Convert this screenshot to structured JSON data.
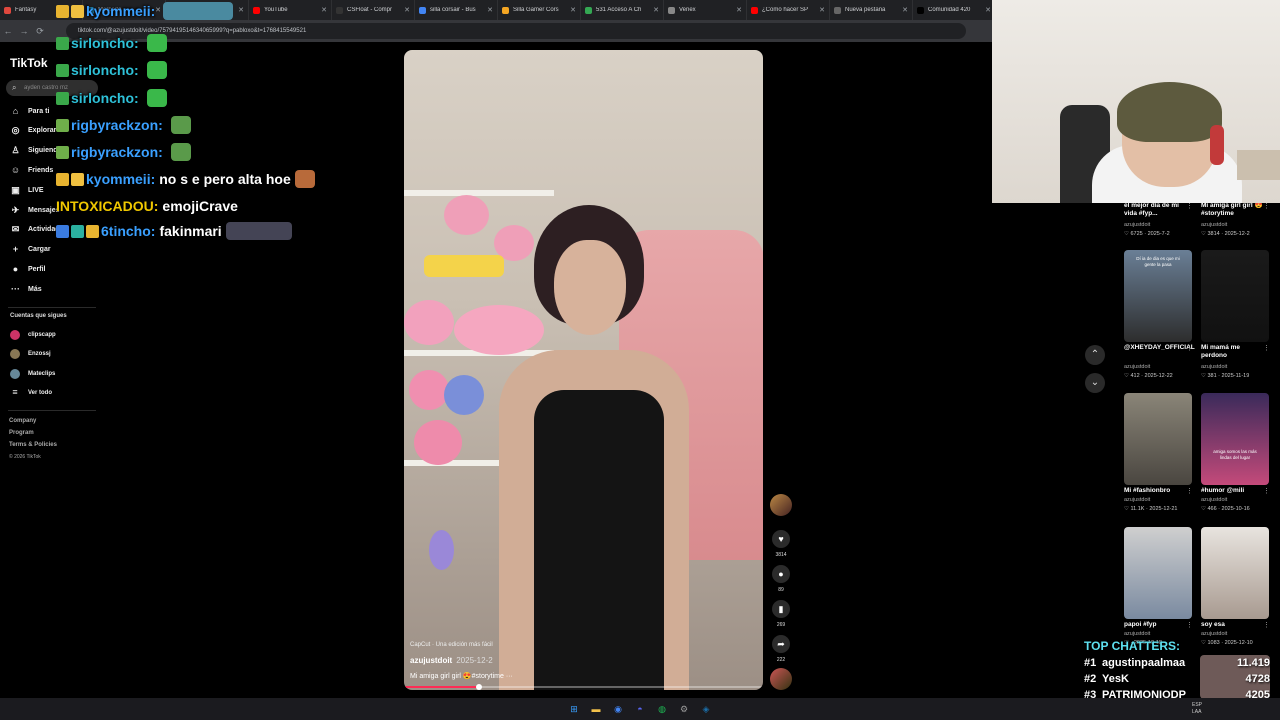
{
  "browser": {
    "tabs": [
      {
        "title": "Fantasy",
        "color": "#e0483e"
      },
      {
        "title": "Mercado",
        "color": "#2aa8e0"
      },
      {
        "title": "Stream",
        "color": "#9147ff"
      },
      {
        "title": "YouTube",
        "color": "#ff0000"
      },
      {
        "title": "CSFloat - Compr",
        "color": "#333"
      },
      {
        "title": "silla corsair - Bus",
        "color": "#4285f4"
      },
      {
        "title": "Silla Gamer Cors",
        "color": "#f5a623"
      },
      {
        "title": "531 Acceso A Ch",
        "color": "#34a853"
      },
      {
        "title": "Venex",
        "color": "#888"
      },
      {
        "title": "¿Como hacer SP",
        "color": "#ff0000"
      },
      {
        "title": "Nueva pestaña",
        "color": "#666"
      },
      {
        "title": "Comunidad 420",
        "color": "#000"
      }
    ],
    "url": "tiktok.com/@azujustdoit/video/7579419514634065999?q=pabloxo&t=1768415549521"
  },
  "sidebar": {
    "logo": "TikTok",
    "search_placeholder": "ayden castro mz",
    "nav": [
      {
        "label": "Para ti",
        "icon": "⌂"
      },
      {
        "label": "Explorar",
        "icon": "◎"
      },
      {
        "label": "Siguiendo",
        "icon": "♙"
      },
      {
        "label": "Friends",
        "icon": "☺"
      },
      {
        "label": "LIVE",
        "icon": "▣"
      },
      {
        "label": "Mensajes",
        "icon": "✈"
      },
      {
        "label": "Actividad",
        "icon": "✉"
      },
      {
        "label": "Cargar",
        "icon": "+"
      },
      {
        "label": "Perfil",
        "icon": "●"
      },
      {
        "label": "Más",
        "icon": "···"
      }
    ],
    "following_heading": "Cuentas que sigues",
    "following": [
      "clipscapp",
      "Enzossj",
      "Mateclips",
      "Ver todo"
    ],
    "footer": [
      "Company",
      "Program",
      "Terms & Policies",
      "© 2026 TikTok"
    ]
  },
  "chat": [
    {
      "user": "kyommeii:",
      "user_color": "#3aa0ff",
      "text": "",
      "badges": [
        "#e8b430",
        "#f0c040"
      ]
    },
    {
      "user": "sirloncho:",
      "user_color": "#2ec1d8",
      "text": "",
      "badges": [
        "#3aa84a"
      ]
    },
    {
      "user": "sirloncho:",
      "user_color": "#2ec1d8",
      "text": "",
      "badges": [
        "#3aa84a"
      ]
    },
    {
      "user": "sirloncho:",
      "user_color": "#2ec1d8",
      "text": "",
      "badges": [
        "#3aa84a"
      ]
    },
    {
      "user": "rigbyrackzon:",
      "user_color": "#3aa0ff",
      "text": "",
      "badges": [
        "#6fae4a"
      ]
    },
    {
      "user": "rigbyrackzon:",
      "user_color": "#3aa0ff",
      "text": "",
      "badges": [
        "#6fae4a"
      ]
    },
    {
      "user": "kyommeii:",
      "user_color": "#3aa0ff",
      "text": "no s e pero alta hoe",
      "badges": [
        "#e8b430",
        "#f0c040"
      ]
    },
    {
      "user": "INTOXICADOU:",
      "user_color": "#f0c800",
      "text": "emojiCrave",
      "badges": []
    },
    {
      "user": "6tincho:",
      "user_color": "#3aa0ff",
      "text": "fakinmari",
      "badges": [
        "#3a7be0",
        "#2bb0a0",
        "#e8b430"
      ]
    }
  ],
  "video": {
    "caption_source": "CapCut · Una edición más fácil",
    "author": "azujustdoit",
    "date": "2025-12-2",
    "description": "Mi amiga girl girl 😍#storytime ···",
    "progress": 0.21
  },
  "actions": [
    {
      "name": "like",
      "icon": "♥",
      "count": "3814"
    },
    {
      "name": "comment",
      "icon": "●",
      "count": "89"
    },
    {
      "name": "save",
      "icon": "▮",
      "count": "269"
    },
    {
      "name": "share",
      "icon": "➦",
      "count": "222"
    }
  ],
  "right_panel": {
    "videos": [
      {
        "caption": "el mejor día de mi vida #fyp...",
        "author": "azujustdoit",
        "likes": "6725",
        "date": "2025-7-2"
      },
      {
        "caption": "Mi amiga girl girl 😍#storytime",
        "author": "azujustdoit",
        "likes": "3814",
        "date": "2025-12-2"
      },
      {
        "caption": "@XHEYDAY_OFFICIAL",
        "author": "azujustdoit",
        "likes": "412",
        "date": "2025-12-22",
        "overlay": "Dí ia de dia es que mi gente la pasa"
      },
      {
        "caption": "Mi mamá me perdono",
        "author": "azujustdoit",
        "likes": "381",
        "date": "2025-11-19"
      },
      {
        "caption": "Mi #fashionbro",
        "author": "azujustdoit",
        "likes": "11.1K",
        "date": "2025-12-21"
      },
      {
        "caption": "#humor @mili",
        "author": "azujustdoit",
        "likes": "466",
        "date": "2025-10-16",
        "overlay": "amiga somos las más lindas del lugar"
      },
      {
        "caption": "papoi #fyp",
        "author": "azujustdoit",
        "likes": "",
        "date": "2025-10-18"
      },
      {
        "caption": "soy esa",
        "author": "azujustdoit",
        "likes": "1083",
        "date": "2025-12-10"
      }
    ]
  },
  "top_chatters": {
    "title": "TOP CHATTERS:",
    "rows": [
      {
        "rank": "#1",
        "name": "agustinpaalmaa",
        "value": "11.419"
      },
      {
        "rank": "#2",
        "name": "YesK",
        "value": "4728"
      },
      {
        "rank": "#3",
        "name": "PATRIMONIODP",
        "value": "4205"
      }
    ]
  },
  "taskbar": {
    "apps": [
      {
        "name": "windows-start",
        "color": "#3aa0ff",
        "icon": "⊞"
      },
      {
        "name": "file-explorer",
        "color": "#f2c14b",
        "icon": "▬"
      },
      {
        "name": "chrome",
        "color": "#4285f4",
        "icon": "◉"
      },
      {
        "name": "discord",
        "color": "#5865f2",
        "icon": "◓"
      },
      {
        "name": "spotify",
        "color": "#1db954",
        "icon": "◍"
      },
      {
        "name": "settings",
        "color": "#999",
        "icon": "⚙"
      },
      {
        "name": "steam",
        "color": "#1b6ea8",
        "icon": "◈"
      }
    ],
    "tray_lang": "ESP LAA"
  }
}
